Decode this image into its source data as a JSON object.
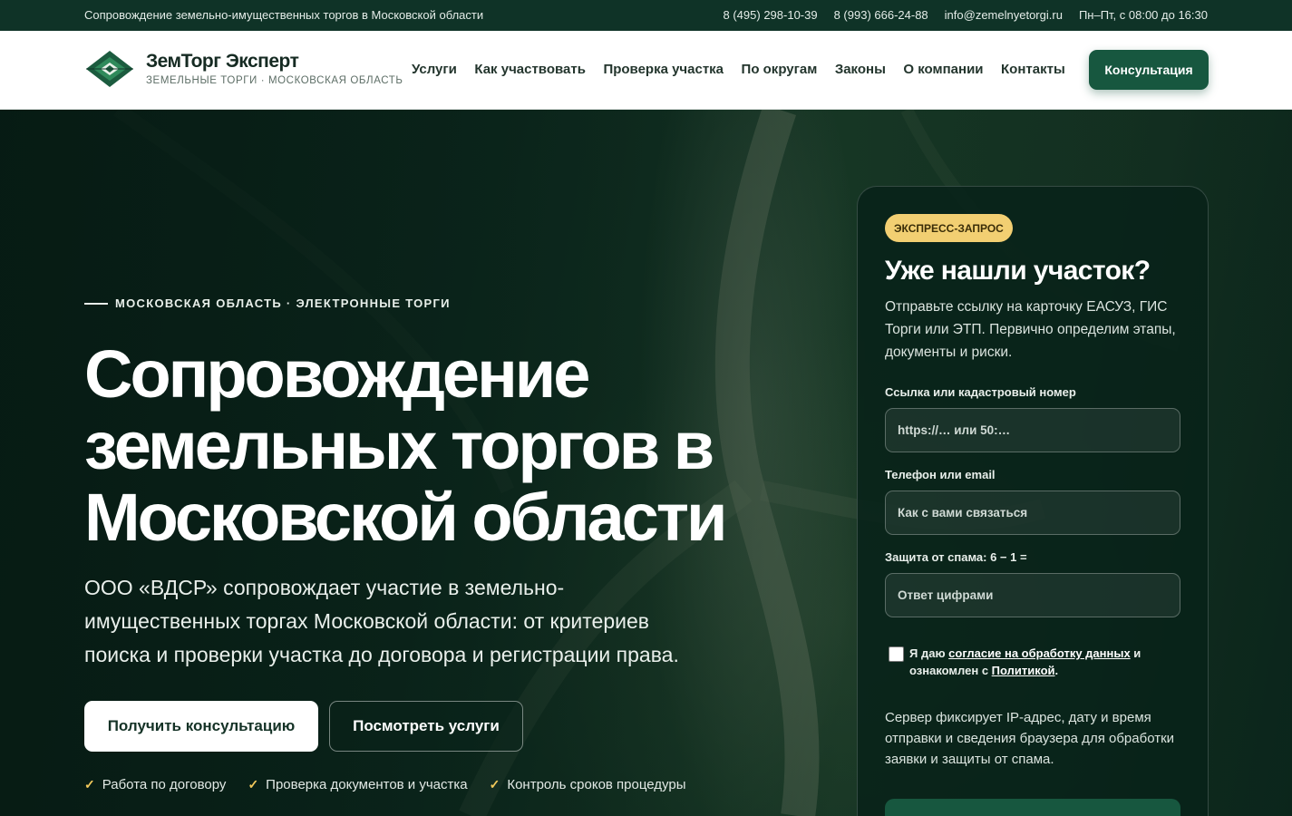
{
  "topbar": {
    "tagline": "Сопровождение земельно-имущественных торгов в Московской области",
    "phone1": "8 (495) 298-10-39",
    "phone2": "8 (993) 666-24-88",
    "email": "info@zemelnyetorgi.ru",
    "hours": "Пн–Пт, с 08:00 до 16:30"
  },
  "header": {
    "brand_name": "ЗемТорг Эксперт",
    "brand_sub": "ЗЕМЕЛЬНЫЕ ТОРГИ · МОСКОВСКАЯ ОБЛАСТЬ",
    "nav": [
      "Услуги",
      "Как участвовать",
      "Проверка участка",
      "По округам",
      "Законы",
      "О компании",
      "Контакты"
    ],
    "cta_label": "Консультация"
  },
  "hero": {
    "eyebrow": "МОСКОВСКАЯ ОБЛАСТЬ · ЭЛЕКТРОННЫЕ ТОРГИ",
    "title": "Сопровождение земельных торгов в Московской области",
    "text": "ООО «ВДСР» сопровождает участие в земельно-имущественных торгах Московской области: от критериев поиска и проверки участка до договора и регистрации права.",
    "primary_button": "Получить консультацию",
    "secondary_button": "Посмотреть услуги",
    "checks": [
      "Работа по договору",
      "Проверка документов и участка",
      "Контроль сроков процедуры"
    ],
    "check_mark": "✓"
  },
  "form": {
    "badge": "ЭКСПРЕСС-ЗАПРОС",
    "title": "Уже нашли участок?",
    "description": "Отправьте ссылку на карточку ЕАСУЗ, ГИС Торги или ЭТП. Первично определим этапы, документы и риски.",
    "link_label": "Ссылка или кадастровый номер",
    "link_placeholder": "https://… или 50:…",
    "contact_label": "Телефон или email",
    "contact_placeholder": "Как с вами связаться",
    "spam_label": "Защита от спама: 6 − 1 =",
    "spam_placeholder": "Ответ цифрами",
    "consent_prefix": "Я даю ",
    "consent_link": "согласие на обработку данных",
    "consent_middle": " и ознакомлен с ",
    "policy_link": "Политикой",
    "consent_suffix": ".",
    "server_note": "Сервер фиксирует IP-адрес, дату и время отправки и сведения браузера для обработки заявки и защиты от спама."
  },
  "colors": {
    "dark_green": "#0f3327",
    "accent_green": "#17573f",
    "badge_yellow": "#f2cf72",
    "check_yellow": "#f2c95b"
  }
}
